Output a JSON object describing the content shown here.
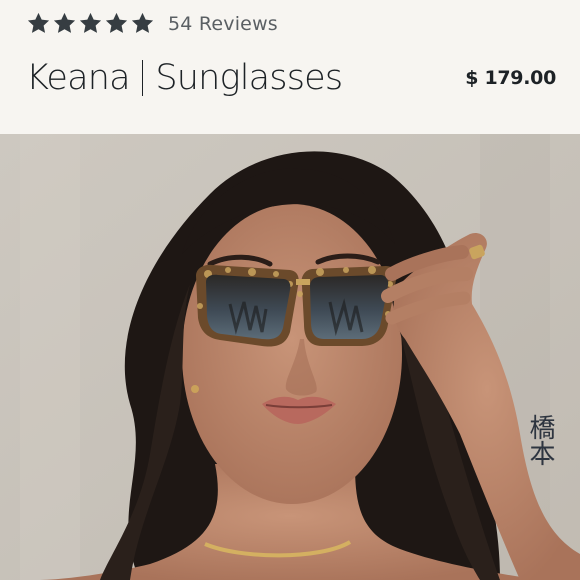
{
  "rating": {
    "stars": 5,
    "max_stars": 5,
    "reviews_label": "54 Reviews"
  },
  "product": {
    "name": "Keana",
    "type": "Sunglasses",
    "price": "$ 179.00"
  },
  "photo": {
    "tattoo_text": "橋本"
  },
  "colors": {
    "star": "#363d42",
    "text": "#1d2226",
    "background": "#f7f5f1"
  }
}
